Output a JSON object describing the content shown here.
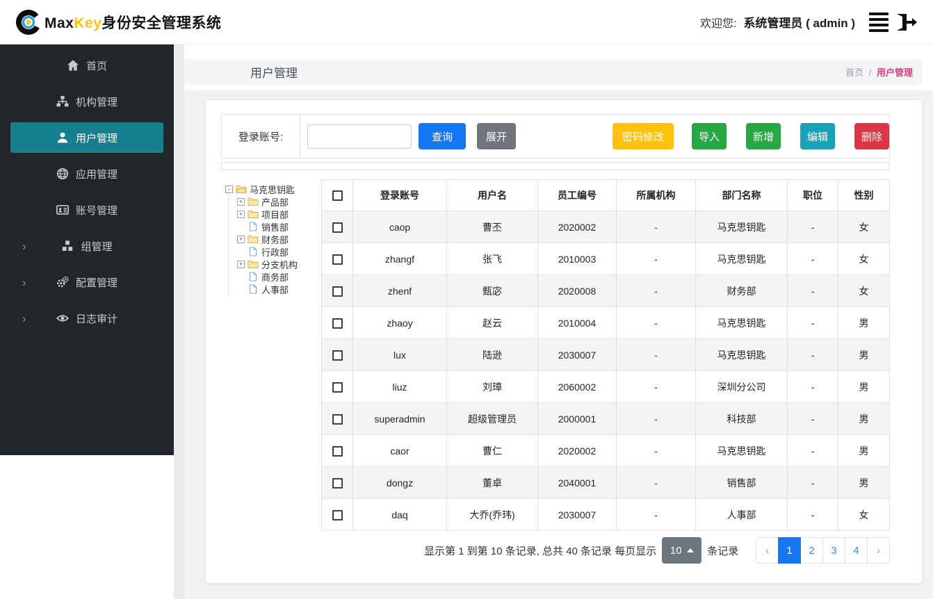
{
  "header": {
    "brand_max": "Max",
    "brand_key": "Key",
    "brand_suffix": "身份安全管理系统",
    "welcome_label": "欢迎您:",
    "username": "系统管理员 ( admin )"
  },
  "icons": {
    "logo-icon": "concentric-circles-C",
    "hamburger-icon": "menu-bars",
    "logout-icon": "door-exit-arrow"
  },
  "sidebar": {
    "items": [
      {
        "key": "home",
        "label": "首页",
        "icon": "home-icon",
        "active": false,
        "has_chevron": false
      },
      {
        "key": "org",
        "label": "机构管理",
        "icon": "sitemap-icon",
        "active": false,
        "has_chevron": false
      },
      {
        "key": "user",
        "label": "用户管理",
        "icon": "user-icon",
        "active": true,
        "has_chevron": false
      },
      {
        "key": "app",
        "label": "应用管理",
        "icon": "globe-icon",
        "active": false,
        "has_chevron": false
      },
      {
        "key": "account",
        "label": "账号管理",
        "icon": "id-card-icon",
        "active": false,
        "has_chevron": false
      },
      {
        "key": "group",
        "label": "组管理",
        "icon": "cubes-icon",
        "active": false,
        "has_chevron": true
      },
      {
        "key": "config",
        "label": "配置管理",
        "icon": "gears-icon",
        "active": false,
        "has_chevron": true
      },
      {
        "key": "audit",
        "label": "日志审计",
        "icon": "eye-icon",
        "active": false,
        "has_chevron": true
      }
    ]
  },
  "page": {
    "title": "用户管理",
    "breadcrumb": {
      "home": "首页",
      "separator": "/",
      "current": "用户管理"
    }
  },
  "search": {
    "label": "登录账号:",
    "input_value": "",
    "query_label": "查询",
    "expand_label": "展开"
  },
  "actions": {
    "change_password": "密码修改",
    "import": "导入",
    "add": "新增",
    "edit": "编辑",
    "delete": "删除"
  },
  "tree": {
    "root": {
      "label": "马克思钥匙",
      "type": "folder-open",
      "expander": "-"
    },
    "children": [
      {
        "label": "产品部",
        "type": "folder",
        "expander": "+"
      },
      {
        "label": "项目部",
        "type": "folder",
        "expander": "+"
      },
      {
        "label": "销售部",
        "type": "leaf",
        "expander": ""
      },
      {
        "label": "财务部",
        "type": "folder",
        "expander": "+"
      },
      {
        "label": "行政部",
        "type": "leaf",
        "expander": ""
      },
      {
        "label": "分支机构",
        "type": "folder",
        "expander": "+"
      },
      {
        "label": "商务部",
        "type": "leaf",
        "expander": ""
      },
      {
        "label": "人事部",
        "type": "leaf",
        "expander": ""
      }
    ]
  },
  "table": {
    "columns": [
      "登录账号",
      "用户名",
      "员工编号",
      "所属机构",
      "部门名称",
      "职位",
      "性别"
    ],
    "column_keys": [
      "login",
      "username",
      "employee-no",
      "org",
      "department",
      "position",
      "gender"
    ],
    "rows": [
      [
        "caop",
        "曹丕",
        "2020002",
        "-",
        "马克思钥匙",
        "-",
        "女"
      ],
      [
        "zhangf",
        "张飞",
        "2010003",
        "-",
        "马克思钥匙",
        "-",
        "女"
      ],
      [
        "zhenf",
        "甄宓",
        "2020008",
        "-",
        "财务部",
        "-",
        "女"
      ],
      [
        "zhaoy",
        "赵云",
        "2010004",
        "-",
        "马克思钥匙",
        "-",
        "男"
      ],
      [
        "lux",
        "陆逊",
        "2030007",
        "-",
        "马克思钥匙",
        "-",
        "男"
      ],
      [
        "liuz",
        "刘璋",
        "2060002",
        "-",
        "深圳分公司",
        "-",
        "男"
      ],
      [
        "superadmin",
        "超级管理员",
        "2000001",
        "-",
        "科技部",
        "-",
        "男"
      ],
      [
        "caor",
        "曹仁",
        "2020002",
        "-",
        "马克思钥匙",
        "-",
        "男"
      ],
      [
        "dongz",
        "董卓",
        "2040001",
        "-",
        "销售部",
        "-",
        "男"
      ],
      [
        "daq",
        "大乔(乔玮)",
        "2030007",
        "-",
        "人事部",
        "-",
        "女"
      ]
    ]
  },
  "pagination": {
    "summary_prefix": "显示第 1 到第 10 条记录, 总共 40 条记录 每页显示",
    "page_size": "10",
    "summary_suffix": "条记录",
    "prev": "‹",
    "next": "›",
    "pages": [
      "1",
      "2",
      "3",
      "4"
    ],
    "active_page": "1"
  },
  "colors": {
    "primary_blue": "#1677f2",
    "success_green": "#28a745",
    "warning_yellow": "#fec10d",
    "info_teal": "#17a2b8",
    "danger_red": "#dc3545",
    "gray_button": "#6e757d",
    "sidebar_bg": "#22262b",
    "sidebar_active": "#17808f",
    "breadcrumb_current": "#e8387d",
    "brand_key_color": "#fdc400"
  }
}
